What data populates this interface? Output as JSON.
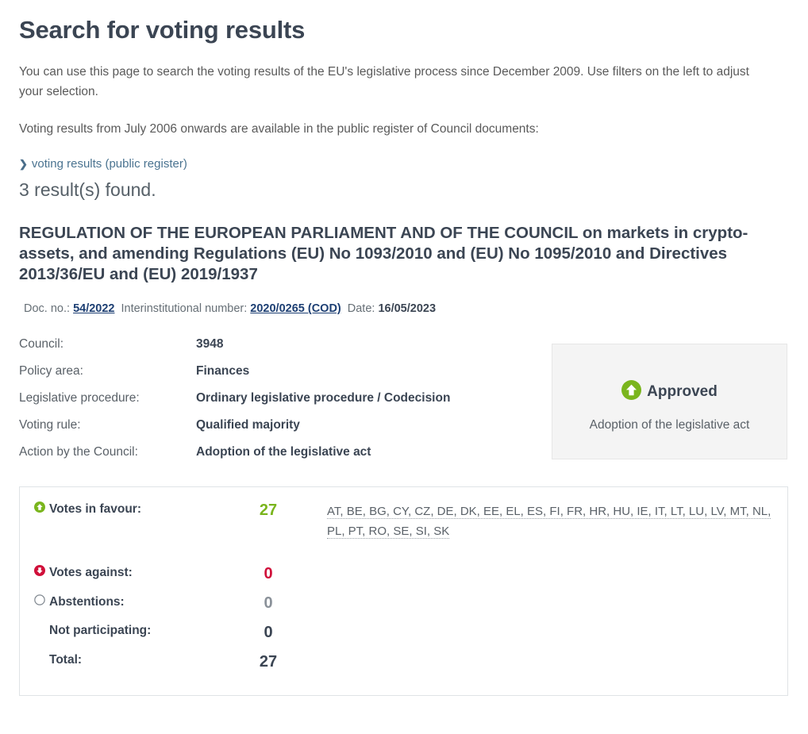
{
  "page": {
    "title": "Search for voting results",
    "intro_1": "You can use this page to search the voting results of the EU's legislative process since December 2009. Use filters on the left to adjust your selection.",
    "intro_2": "Voting results from July 2006 onwards are available in the public register of Council documents:",
    "register_link": "voting results (public register)",
    "register_chevron": "chevron-right-icon",
    "results_found": "3 result(s) found."
  },
  "result": {
    "title": "REGULATION OF THE EUROPEAN PARLIAMENT AND OF THE COUNCIL on markets in crypto-assets, and amending Regulations (EU) No 1093/2010 and (EU) No 1095/2010 and Directives 2013/36/EU and (EU) 2019/1937",
    "doc": {
      "doc_no_label": "Doc. no.:",
      "doc_no_value": "54/2022",
      "interinstitutional_label": "Interinstitutional number:",
      "interinstitutional_value": "2020/0265 (COD)",
      "date_label": "Date:",
      "date_value": "16/05/2023"
    },
    "metadata": [
      {
        "key": "Council:",
        "value": "3948"
      },
      {
        "key": "Policy area:",
        "value": "Finances"
      },
      {
        "key": "Legislative procedure:",
        "value": "Ordinary legislative procedure / Codecision"
      },
      {
        "key": "Voting rule:",
        "value": "Qualified majority"
      },
      {
        "key": "Action by the Council:",
        "value": "Adoption of the legislative act"
      }
    ],
    "status": {
      "icon": "approved-up-arrow-icon",
      "label": "Approved",
      "subtitle": "Adoption of the legislative act"
    },
    "votes": {
      "in_favour": {
        "icon": "vote-up-arrow-icon",
        "label": "Votes in favour:",
        "count": "27",
        "countries": "AT, BE, BG, CY, CZ, DE, DK, EE, EL, ES, FI, FR, HR, HU, IE, IT, LT, LU, LV, MT, NL, PL, PT, RO, SE, SI, SK"
      },
      "against": {
        "icon": "vote-down-arrow-icon",
        "label": "Votes against:",
        "count": "0",
        "countries": ""
      },
      "abstentions": {
        "icon": "vote-circle-icon",
        "label": "Abstentions:",
        "count": "0",
        "countries": ""
      },
      "not_participating": {
        "label": "Not participating:",
        "count": "0",
        "countries": ""
      },
      "total": {
        "label": "Total:",
        "count": "27",
        "countries": ""
      }
    }
  },
  "colors": {
    "green": "#7ab51d",
    "red": "#d0103a",
    "grey": "#8a9199",
    "heading": "#3b4553",
    "link": "#1d3f73",
    "register_link": "#4a7390"
  }
}
